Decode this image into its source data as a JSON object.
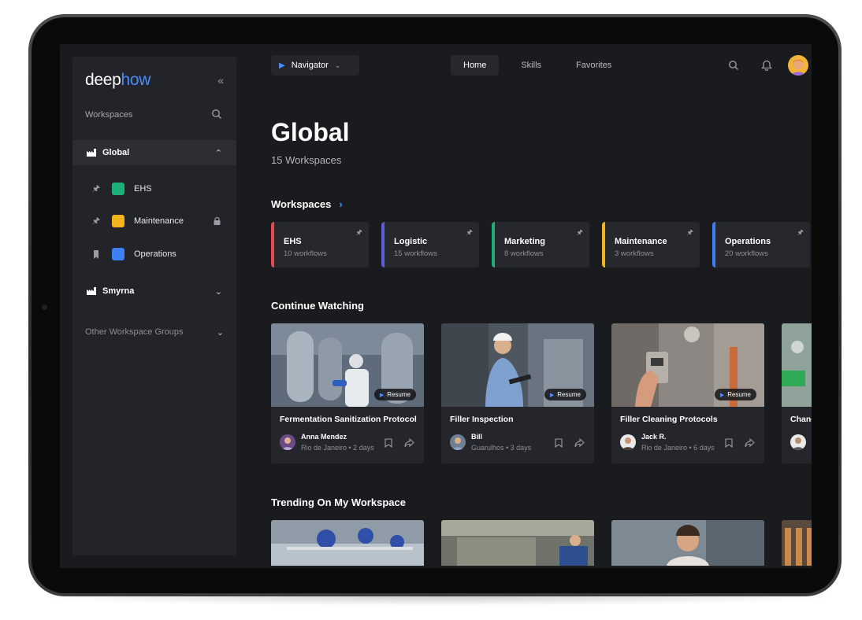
{
  "app": {
    "logo_part1": "deep",
    "logo_part2": "how",
    "collapse_glyph": "«"
  },
  "sidebar": {
    "workspaces_label": "Workspaces",
    "groups": [
      {
        "name": "Global",
        "expanded": true
      },
      {
        "name": "Smyrna",
        "expanded": false
      }
    ],
    "items": [
      {
        "name": "EHS",
        "color": "#1fb07a",
        "icon": "pin-icon",
        "locked": false
      },
      {
        "name": "Maintenance",
        "color": "#f2b31f",
        "icon": "pin-icon",
        "locked": true
      },
      {
        "name": "Operations",
        "color": "#3d7ff5",
        "icon": "bookmark-icon",
        "locked": false
      }
    ],
    "other_groups_label": "Other Workspace Groups"
  },
  "topbar": {
    "navigator_label": "Navigator",
    "tabs": [
      {
        "label": "Home",
        "active": true
      },
      {
        "label": "Skills",
        "active": false
      },
      {
        "label": "Favorites",
        "active": false
      }
    ]
  },
  "main": {
    "title": "Global",
    "subtitle": "15 Workspaces",
    "workspaces_heading": "Workspaces",
    "workspace_cards": [
      {
        "name": "EHS",
        "count": "10 workflows",
        "color": "#e84a55"
      },
      {
        "name": "Logistic",
        "count": "15 workflows",
        "color": "#5b5fd6"
      },
      {
        "name": "Marketing",
        "count": "8 workflows",
        "color": "#1fb07a"
      },
      {
        "name": "Maintenance",
        "count": "3 workflows",
        "color": "#f2b31f"
      },
      {
        "name": "Operations",
        "count": "20 workflows",
        "color": "#3d7ff5"
      }
    ],
    "continue_heading": "Continue Watching",
    "resume_label": "Resume",
    "videos": [
      {
        "title": "Fermentation Sanitization Protocol",
        "author": "Anna Mendez",
        "meta": "Rio de Janeiro • 2 days"
      },
      {
        "title": "Filler Inspection",
        "author": "Bill",
        "meta": "Guarulhos • 3 days"
      },
      {
        "title": "Filler Cleaning Protocols",
        "author": "Jack R.",
        "meta": "Rio de Janeiro • 6 days"
      },
      {
        "title": "Changi",
        "author": "J",
        "meta": "R"
      }
    ],
    "trending_heading": "Trending On My Workspace"
  }
}
